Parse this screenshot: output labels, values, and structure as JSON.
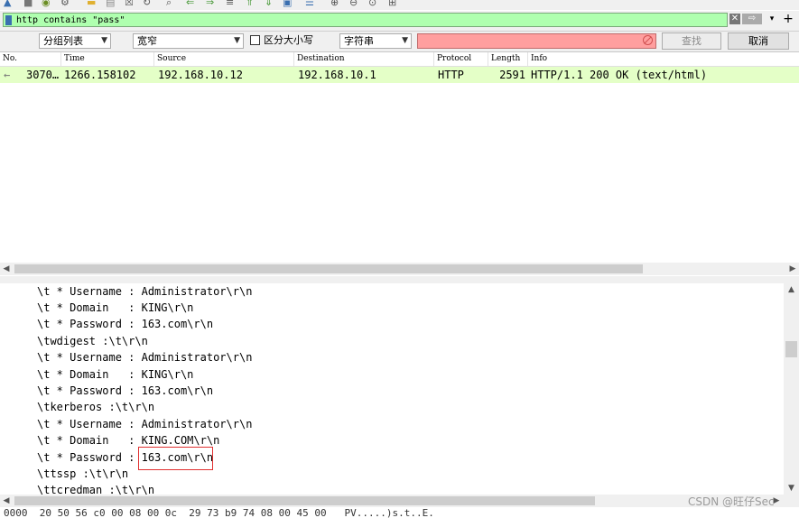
{
  "toolbar": {
    "icons": [
      "start-capture-icon",
      "stop-capture-icon",
      "restart-capture-icon",
      "capture-options-icon",
      "open-file-icon",
      "save-file-icon",
      "close-file-icon",
      "reload-icon",
      "find-packet-icon",
      "go-back-icon",
      "go-forward-icon",
      "go-to-packet-icon",
      "first-packet-icon",
      "last-packet-icon",
      "autoscroll-icon",
      "colorize-icon",
      "zoom-in-icon",
      "zoom-out-icon",
      "normal-size-icon",
      "resize-columns-icon"
    ]
  },
  "filter": {
    "value": "http contains \"pass\"",
    "background_color": "#afffaf"
  },
  "findbar": {
    "search_in": "分组列表",
    "char_width": "宽窄",
    "case_sensitive_label": "区分大小写",
    "search_type": "字符串",
    "search_value": "",
    "find_label": "查找",
    "cancel_label": "取消"
  },
  "packet_list": {
    "columns": [
      "No.",
      "Time",
      "Source",
      "Destination",
      "Protocol",
      "Length",
      "Info"
    ],
    "rows": [
      {
        "no": "3070…",
        "time": "1266.158102",
        "source": "192.168.10.12",
        "destination": "192.168.10.1",
        "protocol": "HTTP",
        "length": "2591",
        "info": "HTTP/1.1 200 OK  (text/html)",
        "row_color": "#e4ffc7"
      }
    ]
  },
  "detail_lines": [
    "\\t * Username : Administrator\\r\\n",
    "\\t * Domain   : KING\\r\\n",
    "\\t * Password : 163.com\\r\\n",
    "\\twdigest :\\t\\r\\n",
    "\\t * Username : Administrator\\r\\n",
    "\\t * Domain   : KING\\r\\n",
    "\\t * Password : 163.com\\r\\n",
    "\\tkerberos :\\t\\r\\n",
    "\\t * Username : Administrator\\r\\n",
    "\\t * Domain   : KING.COM\\r\\n",
    "\\t * Password : 163.com\\r\\n",
    "\\ttssp :\\t\\r\\n",
    "\\ttcredman :\\t\\r\\n"
  ],
  "bytes_line": "0000  20 50 56 c0 00 08 00 0c  29 73 b9 74 08 00 45 00   PV.....)s.t..E.",
  "watermark": "CSDN @旺仔Sec",
  "highlight_color": "#e03030"
}
